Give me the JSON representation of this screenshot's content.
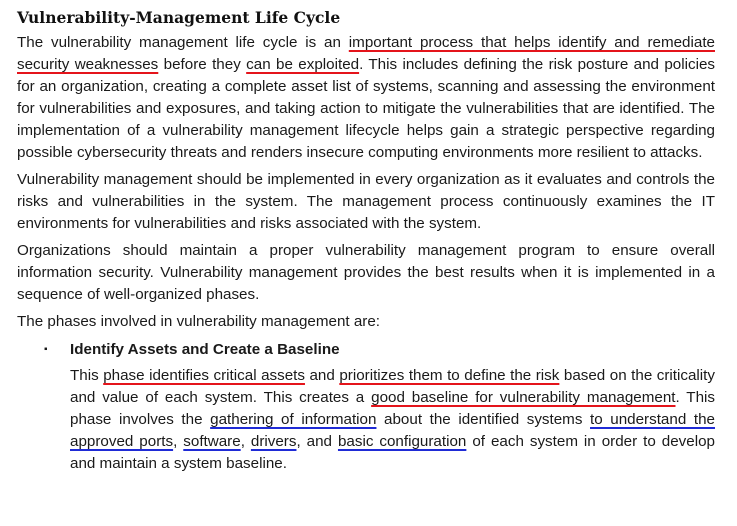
{
  "title": "Vulnerability-Management Life Cycle",
  "p1": {
    "t1": "The vulnerability management life cycle is an ",
    "u1": "important process that helps identify and remediate security weaknesses",
    "t2": " before they ",
    "u2": "can be exploited",
    "t3": ". This includes defining the risk posture and policies for an organization, creating a complete asset list of systems, scanning and assessing the environment for vulnerabilities and exposures, and taking action to mitigate the vulnerabilities that are identified. The implementation of a vulnerability management lifecycle helps gain a strategic perspective regarding possible cybersecurity threats and renders insecure computing environments more resilient to attacks."
  },
  "p2": "Vulnerability management should be implemented in every organization as it evaluates and controls the risks and vulnerabilities in the system. The management process continuously examines the IT environments for vulnerabilities and risks associated with the system.",
  "p3": "Organizations should maintain a proper vulnerability management program to ensure overall information security. Vulnerability management provides the best results when it is implemented in a sequence of well-organized phases.",
  "p4": "The phases involved in vulnerability management are:",
  "bullet": {
    "mark": "▪",
    "heading": "Identify Assets and Create a Baseline",
    "t1": "This ",
    "u1": "phase identifies critical assets",
    "t2": " and ",
    "u2": "prioritizes them to define the risk",
    "t3": " based on the criticality and value of each system. This creates a ",
    "u3": "good baseline for vulnerability management",
    "t4": ". This phase involves the ",
    "b1": "gathering of information",
    "t5": " about the identified systems ",
    "b2": "to understand the approved ports",
    "t6": ", ",
    "b3": "software",
    "t7": ", ",
    "b4": "drivers",
    "t8": ", and ",
    "b5": "basic configuration",
    "t9": " of each system in order to develop and maintain a system baseline."
  },
  "colors": {
    "red_underline": "#e4141b",
    "blue_underline": "#1f2bd6"
  }
}
